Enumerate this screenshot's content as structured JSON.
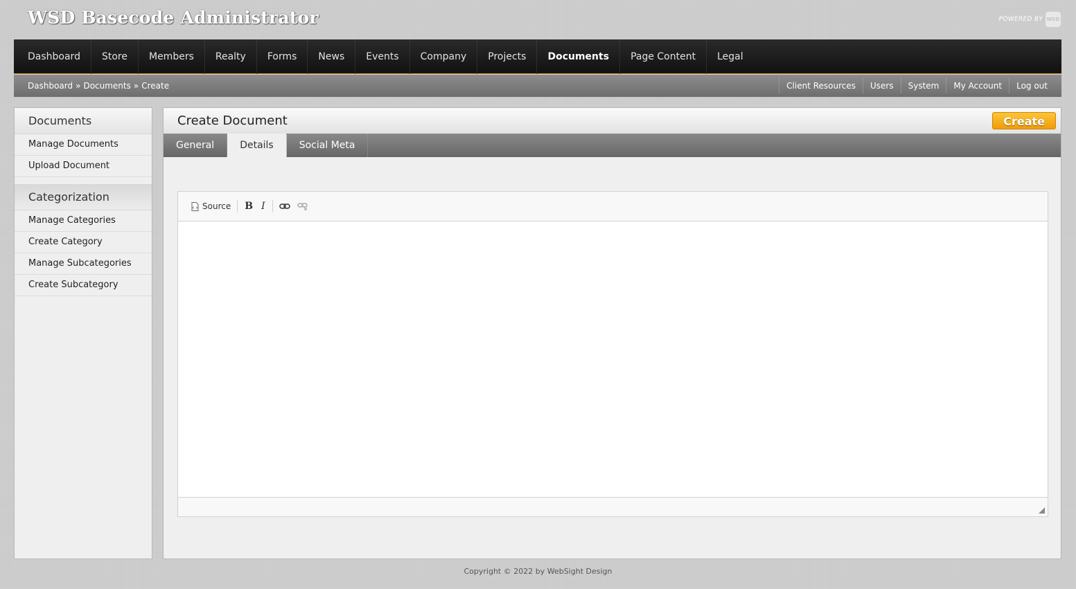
{
  "header": {
    "app_title": "WSD Basecode Administrator",
    "powered_by": "POWERED BY",
    "logo_text": "WSD"
  },
  "nav": {
    "items": [
      {
        "label": "Dashboard"
      },
      {
        "label": "Store"
      },
      {
        "label": "Members"
      },
      {
        "label": "Realty"
      },
      {
        "label": "Forms"
      },
      {
        "label": "News"
      },
      {
        "label": "Events"
      },
      {
        "label": "Company"
      },
      {
        "label": "Projects"
      },
      {
        "label": "Documents"
      },
      {
        "label": "Page Content"
      },
      {
        "label": "Legal"
      }
    ],
    "active": "Documents"
  },
  "breadcrumb": {
    "items": [
      "Dashboard",
      "Documents",
      "Create"
    ],
    "separator": "»"
  },
  "utility_links": [
    "Client Resources",
    "Users",
    "System",
    "My Account",
    "Log out"
  ],
  "sidebar": {
    "section1_title": "Documents",
    "section1_links": [
      "Manage Documents",
      "Upload Document"
    ],
    "section2_title": "Categorization",
    "section2_links": [
      "Manage Categories",
      "Create Category",
      "Manage Subcategories",
      "Create Subcategory"
    ]
  },
  "main": {
    "title": "Create Document",
    "create_label": "Create",
    "tabs": [
      "General",
      "Details",
      "Social Meta"
    ],
    "active_tab": "Details"
  },
  "editor": {
    "source_label": "Source",
    "bold_label": "B",
    "italic_label": "I",
    "content": ""
  },
  "footer": {
    "copyright": "Copyright © 2022 by WebSight Design"
  },
  "colors": {
    "accent": "#f3a910",
    "nav_background": "#1c1c1c",
    "subbar_background": "#7c7c7c"
  }
}
